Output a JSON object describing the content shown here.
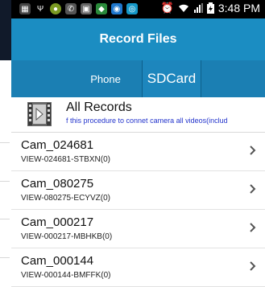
{
  "status_bar": {
    "time": "3:48 PM"
  },
  "header": {
    "title": "Record Files"
  },
  "tabs": [
    {
      "label": "Phone"
    },
    {
      "label": "SDCard"
    }
  ],
  "all_records": {
    "title": "All Records",
    "subtitle": "f this procedure to connet camera all videos(includ"
  },
  "cameras": [
    {
      "name": "Cam_024681",
      "id": "VIEW-024681-STBXN(0)"
    },
    {
      "name": "Cam_080275",
      "id": "VIEW-080275-ECYVZ(0)"
    },
    {
      "name": "Cam_000217",
      "id": "VIEW-000217-MBHKB(0)"
    },
    {
      "name": "Cam_000144",
      "id": "VIEW-000144-BMFFK(0)"
    }
  ],
  "colors": {
    "title_bar": "#1b8dc2",
    "tab_bar": "#1b7fb3",
    "link_text": "#2233cc"
  }
}
